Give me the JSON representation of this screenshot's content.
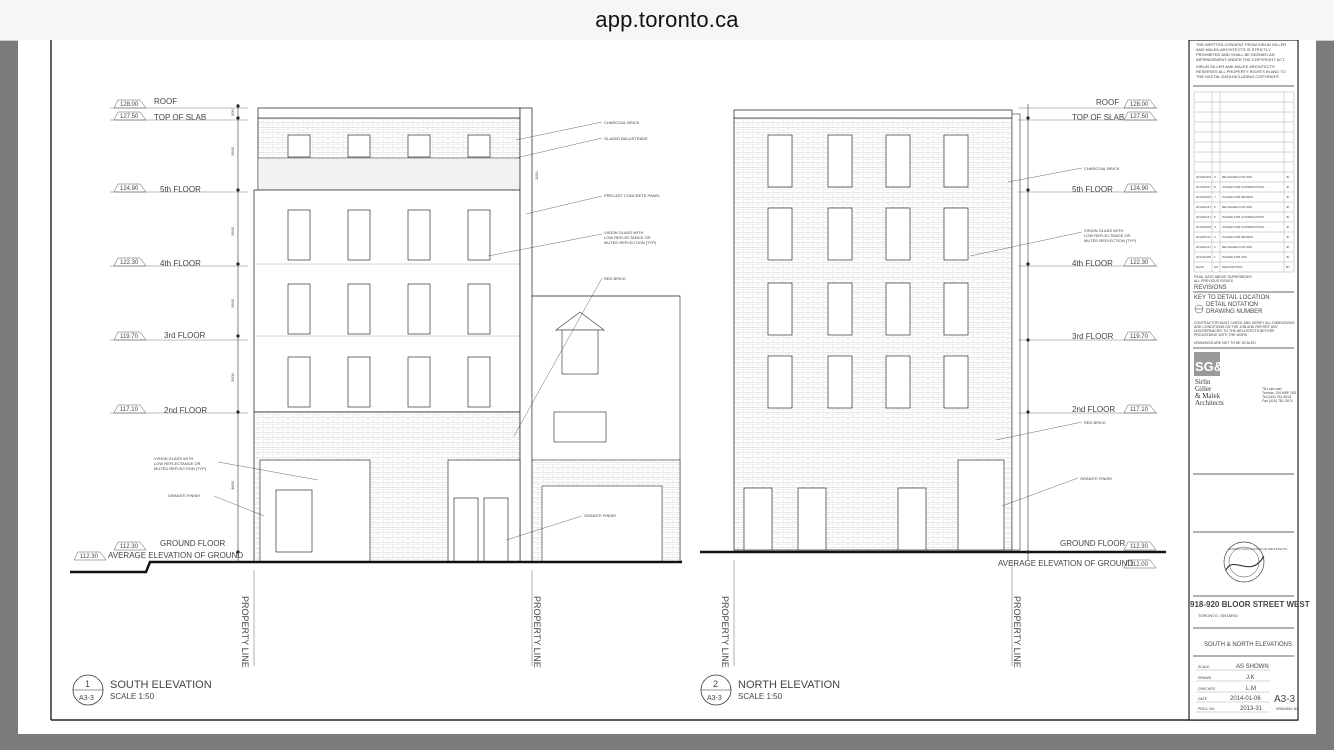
{
  "browser": {
    "url": "app.toronto.ca"
  },
  "levels": {
    "roof": {
      "label": "ROOF",
      "elev": "128.00"
    },
    "top_slab": {
      "label": "TOP OF SLAB",
      "elev": "127.50"
    },
    "fifth": {
      "label": "5th FLOOR",
      "elev": "124.90"
    },
    "fourth": {
      "label": "4th FLOOR",
      "elev": "122.30"
    },
    "third": {
      "label": "3rd FLOOR",
      "elev": "119.70"
    },
    "second": {
      "label": "2nd FLOOR",
      "elev": "117.10"
    },
    "ground": {
      "label": "GROUND FLOOR",
      "elev": "112.30"
    },
    "avg_south": {
      "label": "AVERAGE ELEVATION OF GROUND",
      "elev": "112.30"
    },
    "avg_north": {
      "label": "AVERAGE ELEVATION OF GROUND",
      "elev": "112.00"
    }
  },
  "notes": {
    "charcoal_brick": "CHARCOAL BRICK",
    "glazed_balustrade": "GLAZED BALUSTRADE",
    "precast_panel": "PRECAST CONCRETE PANEL",
    "vision_glass": [
      "VISION GLASS WITH",
      "LOW REFLECTANCE OR",
      "MUTED REFLECTION (TYP)"
    ],
    "red_brick": "RED BRICK",
    "granite_finish": "GRANITE FINISH"
  },
  "property_line": "PROPERTY LINE",
  "views": {
    "south": {
      "number": "1",
      "sheet": "A3-3",
      "title": "SOUTH ELEVATION",
      "scale": "SCALE 1:50"
    },
    "north": {
      "number": "2",
      "sheet": "A3-3",
      "title": "NORTH ELEVATION",
      "scale": "SCALE 1:50"
    }
  },
  "dims": {
    "d1": "2600",
    "d2": "2600",
    "d3": "2600",
    "d4": "2600",
    "d5": "4800",
    "d6": "500",
    "d7": "1100"
  },
  "titleblock": {
    "copyright": [
      "THE WRITTEN CONSENT FROM SIRLIN GILLER",
      "AND MALEK ARCHITECTS IS STRICTLY",
      "PROHIBITED AND SHALL BE DEEMED AN",
      "INFRINGEMENT UNDER THE COPYRIGHT ACT.",
      "",
      "SIRLIN GILLER AND MALEK ARCHITECTS",
      "RESERVES ALL PROPERTY RIGHTS IN AND TO",
      "THE DIGITAL DATA INCLUDING COPYRIGHT."
    ],
    "revisions": [
      {
        "date": "2014/04/03",
        "no": "9",
        "desc": "RE-ISSUED FOR SPA",
        "by": "JK"
      },
      {
        "date": "2014/03/27",
        "no": "8",
        "desc": "ISSUED FOR COORDINATION",
        "by": "JK"
      },
      {
        "date": "2014/03/05",
        "no": "7",
        "desc": "ISSUED FOR REVIEW",
        "by": "JK"
      },
      {
        "date": "2014/02/27",
        "no": "6",
        "desc": "RE-ISSUED FOR SPA",
        "by": "JK"
      },
      {
        "date": "2014/02/17",
        "no": "5",
        "desc": "ISSUED FOR COORDINATION",
        "by": "JK"
      },
      {
        "date": "2014/02/06",
        "no": "4",
        "desc": "ISSUED FOR COORDINATION",
        "by": "JK"
      },
      {
        "date": "2014/01/31",
        "no": "3",
        "desc": "ISSUED FOR REVIEW",
        "by": "JK"
      },
      {
        "date": "2014/01/27",
        "no": "2",
        "desc": "RE-ISSUED FOR SPA",
        "by": "JK"
      },
      {
        "date": "2014/01/06",
        "no": "1",
        "desc": "ISSUED FOR SPA",
        "by": "JK"
      }
    ],
    "rev_header": {
      "date": "DATE",
      "no": "NO",
      "desc": "DESCRIPTION",
      "by": "BY"
    },
    "final_note": [
      "FINAL DATE ABOVE SUPERSEDES",
      "ALL PREVIOUS ISSUES"
    ],
    "revisions_label": "REVISIONS",
    "key_label": "KEY TO DETAIL LOCATION",
    "detail_notation": "DETAIL NOTATION",
    "drawing_number": "DRAWING NUMBER",
    "contractor_note": [
      "CONTRACTOR MUST CHECK AND VERIFY ALL DIMENSIONS",
      "AND CONDITIONS ON THE JOB AND REPORT ANY",
      "DISCREPANCIES TO THE ARCHITECTS BEFORE",
      "PROCEEDING WITH THE WORK."
    ],
    "no_scale": "DRAWINGS ARE NOT TO BE SCALED",
    "firm_logo": "SG&M",
    "firm_name": [
      "Sirlin",
      "Giller",
      "& Malek",
      "Architects"
    ],
    "firm_address": [
      "78 Lola road",
      "Toronto, ON M5P 1E5",
      "Tel.(416) 781-8223",
      "Fax (416) 781-2674"
    ],
    "seal": "ONTARIO ASSOCIATION OF ARCHITECTS",
    "project": "918-920 BLOOR STREET WEST",
    "city": "TORONTO, ONTARIO",
    "sheet_title": "SOUTH & NORTH ELEVATIONS",
    "scale_label": "SCALE",
    "scale_value": "AS SHOWN",
    "drawn_label": "DRAWN",
    "drawn_value": "J.K",
    "checked_label": "CHECKED",
    "checked_value": "L.M",
    "date_label": "DATE",
    "date_value": "2014-01-06",
    "proj_label": "PROJ. NO",
    "proj_value": "2013-31",
    "sheet_no": "A3-3",
    "drawing_no_label": "DRAWING NO"
  }
}
